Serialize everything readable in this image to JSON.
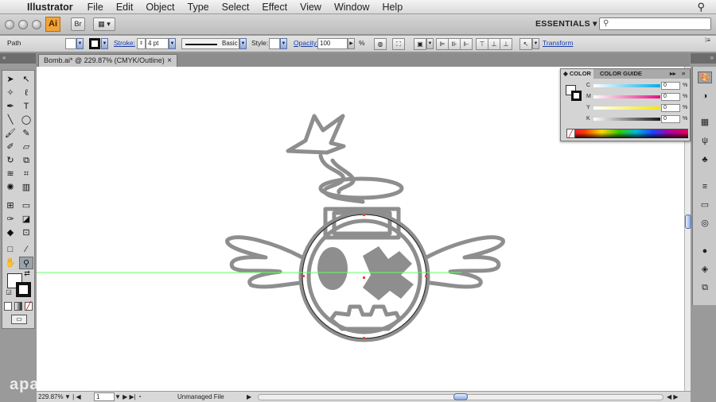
{
  "menubar": {
    "app_name": "Illustrator",
    "items": [
      "File",
      "Edit",
      "Object",
      "Type",
      "Select",
      "Effect",
      "View",
      "Window",
      "Help"
    ]
  },
  "appbar": {
    "logo": "Ai",
    "workspace": "ESSENTIALS ▾",
    "search_placeholder": "",
    "bridge_label": "Br"
  },
  "control": {
    "selection_label": "Path",
    "stroke_label": "Stroke:",
    "stroke_weight": "4 pt",
    "brush_label": "Basic",
    "style_label": "Style:",
    "opacity_label": "Opacity:",
    "opacity_value": "100",
    "opacity_unit": "%",
    "transform_label": "Transform"
  },
  "document": {
    "tab_title": "Bomb.ai* @ 229.87% (CMYK/Outline)",
    "close": "×"
  },
  "status": {
    "zoom": "229.87%",
    "artboard": "1",
    "info": "Unmanaged File"
  },
  "color_panel": {
    "tab_color": "COLOR",
    "tab_guide": "COLOR GUIDE",
    "channels": [
      {
        "label": "C",
        "value": "0",
        "unit": "%",
        "color": "#00aee8"
      },
      {
        "label": "M",
        "value": "0",
        "unit": "%",
        "color": "#e0137f"
      },
      {
        "label": "Y",
        "value": "0",
        "unit": "%",
        "color": "#f2ea00"
      },
      {
        "label": "K",
        "value": "0",
        "unit": "%",
        "color": "#1a1a1a"
      }
    ]
  },
  "watermark": "apa",
  "colors": {
    "guide_line": "#66ff66",
    "artwork_gray": "#8e8e8e",
    "anchor_red": "#ff3b3b"
  }
}
